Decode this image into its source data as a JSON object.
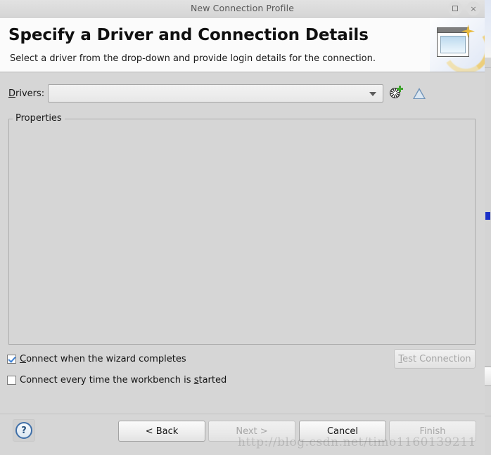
{
  "window": {
    "title": "New Connection Profile",
    "controls": {
      "maximize": "maximize-icon",
      "close": "×"
    }
  },
  "wizard_header": {
    "title": "Specify a Driver and Connection Details",
    "description": "Select a driver from the drop-down and provide login details for the connection.",
    "banner_icon": "wizard-window-sparkle-icon"
  },
  "form": {
    "drivers": {
      "label": "Drivers:",
      "mnemonic": "D",
      "selected_value": "",
      "placeholder": "",
      "dropdown_icon": "chevron-down-icon",
      "new_driver_icon": "new-driver-definition-icon",
      "edit_driver_icon": "edit-driver-definition-icon"
    },
    "properties_group": {
      "label": "Properties",
      "content": ""
    },
    "checkboxes": [
      {
        "label": "Connect when the wizard completes",
        "mnemonic": "C",
        "checked": true
      },
      {
        "label": "Connect every time the workbench is started",
        "mnemonic": "s",
        "checked": false
      }
    ],
    "test_connection": {
      "label": "Test Connection",
      "mnemonic": "T",
      "enabled": false
    }
  },
  "footer": {
    "help": {
      "label": "?",
      "icon": "help-question-icon"
    },
    "buttons": [
      {
        "label": "< Back",
        "enabled": true
      },
      {
        "label": "Next >",
        "enabled": false
      },
      {
        "label": "Cancel",
        "enabled": true
      },
      {
        "label": "Finish",
        "enabled": false
      }
    ]
  },
  "watermark": {
    "text": "http://blog.csdn.net/timo1160139211"
  },
  "colors": {
    "dialog_background": "#d6d6d6",
    "header_background": "#fbfbfb",
    "titlebar_text": "#585858",
    "checkmark": "#3b7fd4",
    "help_icon": "#3f6fa8",
    "disabled_text": "#a6a6a6"
  }
}
